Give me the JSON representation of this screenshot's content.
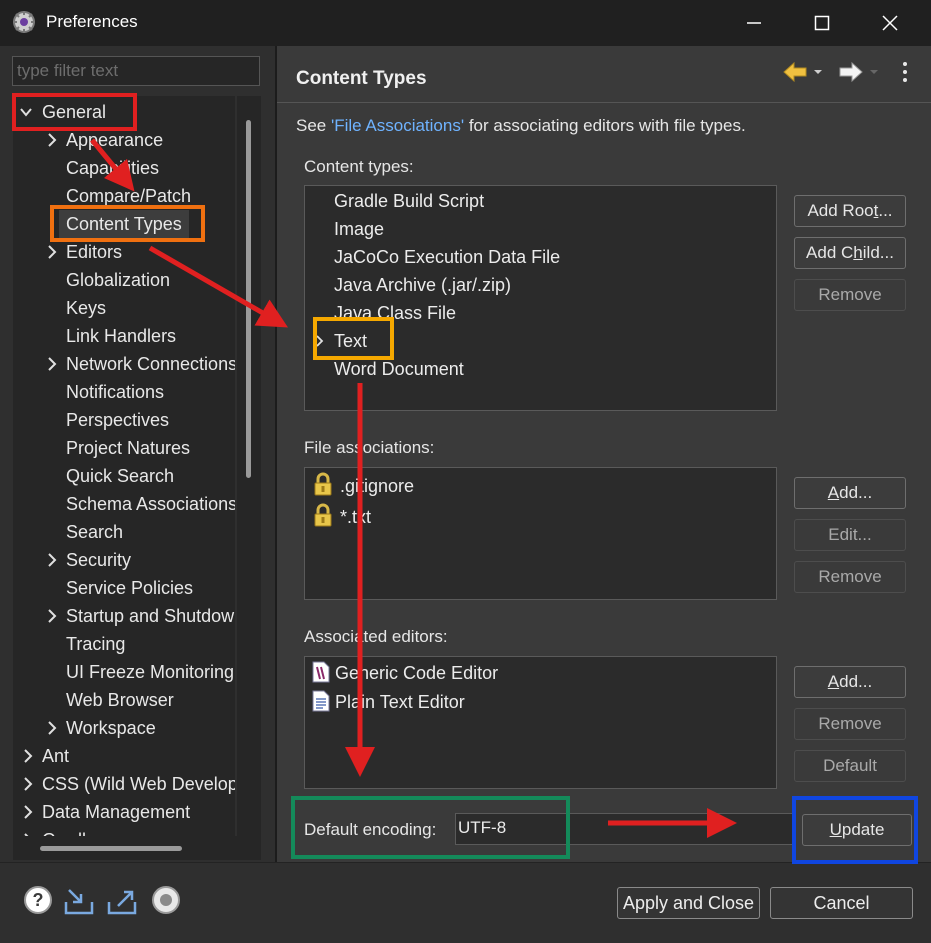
{
  "window": {
    "title": "Preferences"
  },
  "filter": {
    "placeholder": "type filter text"
  },
  "tree": {
    "items": [
      {
        "label": "General",
        "expandable": true,
        "expanded": true
      },
      {
        "label": "Appearance",
        "expandable": true
      },
      {
        "label": "Capabilities",
        "expandable": false
      },
      {
        "label": "Compare/Patch",
        "expandable": false
      },
      {
        "label": "Content Types",
        "expandable": false,
        "selected": true
      },
      {
        "label": "Editors",
        "expandable": true
      },
      {
        "label": "Globalization",
        "expandable": false
      },
      {
        "label": "Keys",
        "expandable": false
      },
      {
        "label": "Link Handlers",
        "expandable": false
      },
      {
        "label": "Network Connections",
        "expandable": true
      },
      {
        "label": "Notifications",
        "expandable": false
      },
      {
        "label": "Perspectives",
        "expandable": false
      },
      {
        "label": "Project Natures",
        "expandable": false
      },
      {
        "label": "Quick Search",
        "expandable": false
      },
      {
        "label": "Schema Associations",
        "expandable": false
      },
      {
        "label": "Search",
        "expandable": false
      },
      {
        "label": "Security",
        "expandable": true
      },
      {
        "label": "Service Policies",
        "expandable": false
      },
      {
        "label": "Startup and Shutdown",
        "expandable": true
      },
      {
        "label": "Tracing",
        "expandable": false
      },
      {
        "label": "UI Freeze Monitoring",
        "expandable": false
      },
      {
        "label": "Web Browser",
        "expandable": false
      },
      {
        "label": "Workspace",
        "expandable": true
      },
      {
        "label": "Ant",
        "expandable": true
      },
      {
        "label": "CSS (Wild Web Developer)",
        "expandable": true
      },
      {
        "label": "Data Management",
        "expandable": true
      },
      {
        "label": "Gradle",
        "expandable": true
      }
    ]
  },
  "page": {
    "title": "Content Types",
    "see_prefix": "See ",
    "see_link": "'File Associations'",
    "see_suffix": " for associating editors with file types."
  },
  "content_types": {
    "label": "Content types:",
    "items": [
      "Gradle Build Script",
      "Image",
      "JaCoCo Execution Data File",
      "Java Archive (.jar/.zip)",
      "Java Class File",
      "Text",
      "Word Document"
    ],
    "selected": "Text",
    "buttons": {
      "add_root": "Add Root...",
      "add_child": "Add Child...",
      "remove": "Remove"
    }
  },
  "file_associations": {
    "label": "File associations:",
    "items": [
      ".gitignore",
      "*.txt"
    ],
    "buttons": {
      "add": "Add...",
      "edit": "Edit...",
      "remove": "Remove"
    }
  },
  "associated_editors": {
    "label": "Associated editors:",
    "items": [
      "Generic Code Editor",
      "Plain Text Editor"
    ],
    "buttons": {
      "add": "Add...",
      "remove": "Remove",
      "default": "Default"
    }
  },
  "encoding": {
    "label": "Default encoding:",
    "value": "UTF-8",
    "update": "Update"
  },
  "footer": {
    "apply_close": "Apply and Close",
    "cancel": "Cancel"
  },
  "colors": {
    "annotation_red": "#e02020",
    "annotation_orange": "#f07010",
    "annotation_yellow": "#f5a800",
    "annotation_green": "#148a5a",
    "annotation_blue": "#1046e0",
    "link": "#6fb3ff"
  },
  "icons": [
    "preferences-app-icon",
    "minimize-icon",
    "maximize-icon",
    "close-icon",
    "back-arrow-icon",
    "forward-arrow-icon",
    "view-menu-icon",
    "lock-icon",
    "text-editor-icon",
    "help-icon",
    "import-icon",
    "export-icon",
    "record-icon"
  ]
}
